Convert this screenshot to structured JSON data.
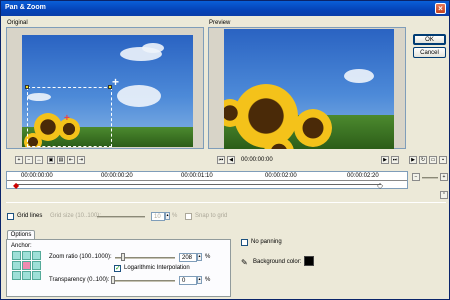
{
  "window": {
    "title": "Pan & Zoom"
  },
  "panels": {
    "original": "Original",
    "preview": "Preview"
  },
  "buttons": {
    "ok": "OK",
    "cancel": "Cancel"
  },
  "timecode": "00:00:00:00",
  "timeline": {
    "ticks": [
      "00:00:00:00",
      "00:00:00:20",
      "00:00:01:10",
      "00:00:02:00",
      "00:00:02:20"
    ]
  },
  "grid": {
    "grid_lines": "Grid lines",
    "grid_size_label": "Grid size (10..100):",
    "grid_size_value": "10",
    "snap_label": "Snap to grid"
  },
  "tabs": {
    "options": "Options"
  },
  "options": {
    "anchor": "Anchor:",
    "zoom_label": "Zoom ratio (100..1000):",
    "zoom_value": "208",
    "zoom_unit": "%",
    "log_interp": "Logarithmic Interpolation",
    "transparency_label": "Transparency (0..100):",
    "transparency_value": "0",
    "transparency_unit": "%"
  },
  "right_options": {
    "no_panning": "No panning",
    "background_color": "Background color:",
    "background_color_value": "#000000"
  },
  "icons": [
    "close-icon",
    "play-icon",
    "first-frame-icon",
    "prev-frame-icon",
    "next-frame-icon",
    "last-frame-icon",
    "add-keyframe-icon",
    "remove-keyframe-icon",
    "zoom-in-icon",
    "zoom-out-icon",
    "eyedropper-icon"
  ]
}
